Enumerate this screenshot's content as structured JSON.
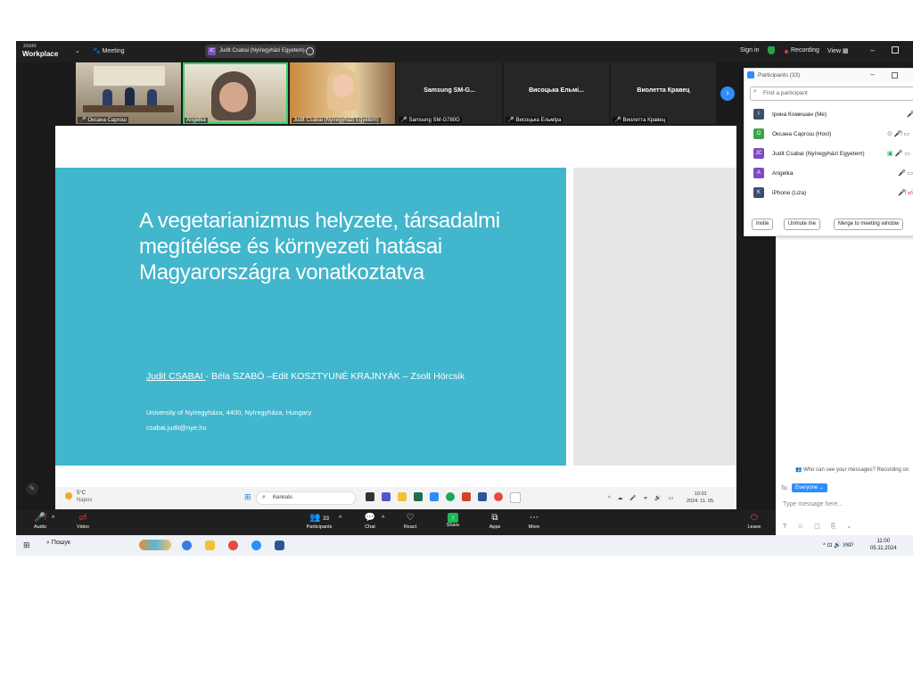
{
  "topbar": {
    "logo_top": "zoom",
    "logo_bottom": "Workplace",
    "meeting_label": "Meeting",
    "speaker_badge_initials": "JC",
    "active_speaker": "Judit Csabai (Nyíregyházi Egyetem)",
    "signin": "Sign in",
    "recording": "Recording",
    "view": "View"
  },
  "thumbnails": [
    {
      "name": "Оксана Саргош",
      "muted": true
    },
    {
      "name": "Angelka",
      "muted": false
    },
    {
      "name": "Judit Csabai (Nyíregyházi Egyetem)",
      "muted": false
    },
    {
      "name": "Samsung SM-G780G",
      "big": "Samsung  SM-G...",
      "muted": true
    },
    {
      "name": "Висоцька Ельміра",
      "big": "Висоцька  Ельмі...",
      "muted": true
    },
    {
      "name": "Виолетта Кравец",
      "big": "Виолетта  Кравец",
      "muted": true
    }
  ],
  "slide": {
    "title": "A vegetarianizmus helyzete, társadalmi megítélése és környezeti hatásai Magyarországra vonatkoztatva",
    "author_underlined": "Judit CSABAI ",
    "authors_rest": "- Béla SZABÓ –Edit KOSZTYUNÉ KRAJNYÁK – Zsolt Hörcsik",
    "university": "University of Nyíregyháza, 4400, Nyíregyháza, Hungary",
    "email": "csabai.judit@nye.hu"
  },
  "inner_taskbar": {
    "temperature": "5°C",
    "weather": "Napos",
    "search": "Keresés",
    "time": "10:01",
    "date": "2024. 11. 05."
  },
  "toolbar": {
    "audio": "Audio",
    "video": "Video",
    "participants_count": "33",
    "participants": "Participants",
    "chat": "Chat",
    "react": "React",
    "share": "Share",
    "apps": "Apps",
    "more": "More",
    "leave": "Leave"
  },
  "participants_panel": {
    "title": "Participants (33)",
    "search_placeholder": "Find a participant",
    "rows": [
      {
        "initial": "I",
        "name": "Ірина Комишан (Me)",
        "color": "#3c4e6a"
      },
      {
        "initial": "O",
        "name": "Оксана Саргош (Host)",
        "color": "#3fa34d"
      },
      {
        "initial": "JC",
        "name": "Judit Csabai (Nyíregyházi Egyetem)",
        "color": "#7c4dbd"
      },
      {
        "initial": "A",
        "name": "Angelka",
        "color": "#7c4dbd"
      },
      {
        "initial": "K",
        "name": "iPhone (Liza)",
        "color": "#3c4e6a"
      }
    ],
    "invite": "Invite",
    "unmute": "Unmute me",
    "merge": "Merge to meeting window"
  },
  "chat": {
    "who_can_see": "Who can see your messages? Recording on",
    "to_label": "To:",
    "recipient": "Everyone",
    "placeholder": "Type message here..."
  },
  "win_taskbar": {
    "search": "Пошук",
    "lang": "УКР",
    "time": "11:00",
    "date": "05.11.2024"
  }
}
